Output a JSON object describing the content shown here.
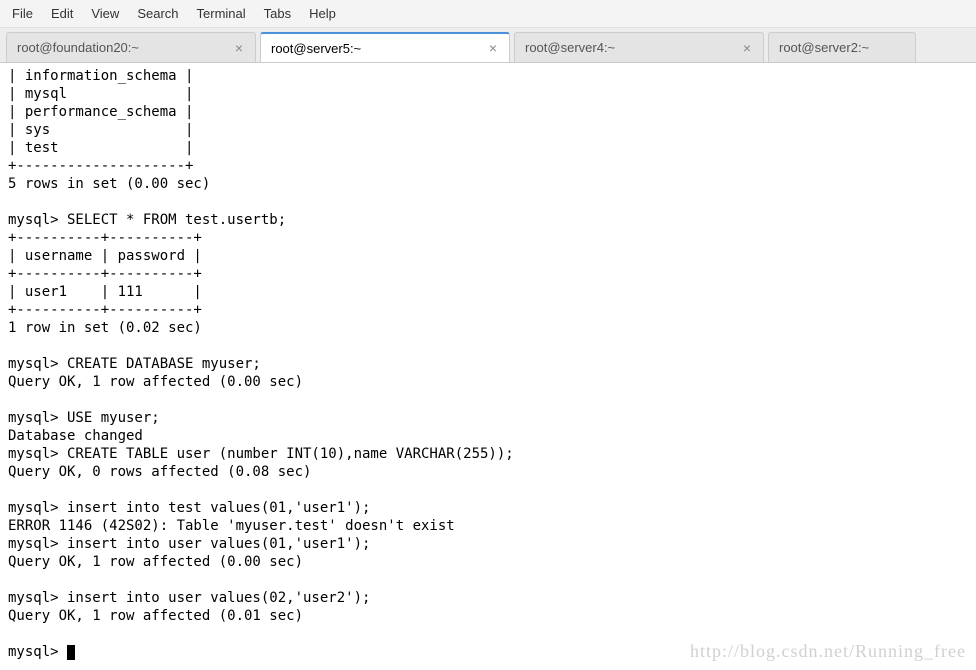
{
  "menubar": {
    "items": [
      "File",
      "Edit",
      "View",
      "Search",
      "Terminal",
      "Tabs",
      "Help"
    ]
  },
  "tabs": [
    {
      "label": "root@foundation20:~",
      "active": false
    },
    {
      "label": "root@server5:~",
      "active": true
    },
    {
      "label": "root@server4:~",
      "active": false
    },
    {
      "label": "root@server2:~",
      "active": false
    }
  ],
  "terminal": {
    "lines": [
      "| information_schema |",
      "| mysql              |",
      "| performance_schema |",
      "| sys                |",
      "| test               |",
      "+--------------------+",
      "5 rows in set (0.00 sec)",
      "",
      "mysql> SELECT * FROM test.usertb;",
      "+----------+----------+",
      "| username | password |",
      "+----------+----------+",
      "| user1    | 111      |",
      "+----------+----------+",
      "1 row in set (0.02 sec)",
      "",
      "mysql> CREATE DATABASE myuser;",
      "Query OK, 1 row affected (0.00 sec)",
      "",
      "mysql> USE myuser;",
      "Database changed",
      "mysql> CREATE TABLE user (number INT(10),name VARCHAR(255));",
      "Query OK, 0 rows affected (0.08 sec)",
      "",
      "mysql> insert into test values(01,'user1');",
      "ERROR 1146 (42S02): Table 'myuser.test' doesn't exist",
      "mysql> insert into user values(01,'user1');",
      "Query OK, 1 row affected (0.00 sec)",
      "",
      "mysql> insert into user values(02,'user2');",
      "Query OK, 1 row affected (0.01 sec)",
      ""
    ],
    "prompt": "mysql> "
  },
  "watermark": "http://blog.csdn.net/Running_free"
}
